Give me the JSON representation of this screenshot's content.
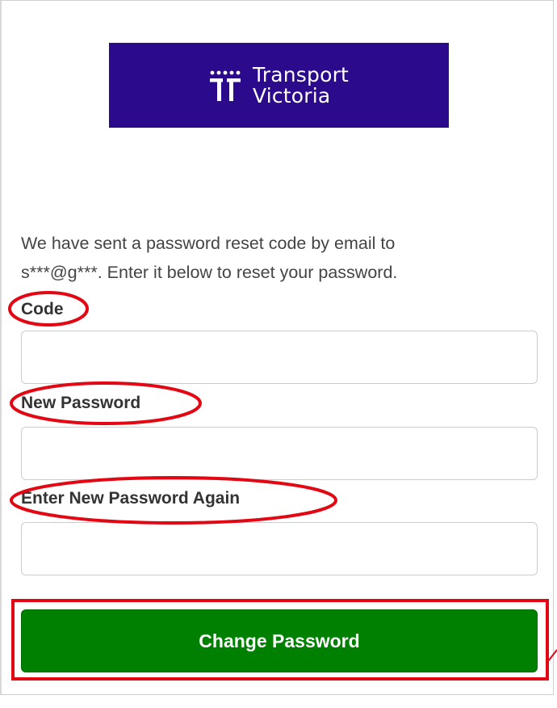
{
  "logo": {
    "line1": "Transport",
    "line2": "Victoria",
    "background": "#2b0a8c"
  },
  "intro": {
    "line1": "We have sent a password reset code by email to",
    "line2": "s***@g***. Enter it below to reset your password."
  },
  "form": {
    "code_label": "Code",
    "code_value": "",
    "new_password_label": "New Password",
    "new_password_value": "",
    "confirm_password_label": "Enter New Password Again",
    "confirm_password_value": "",
    "submit_label": "Change Password"
  },
  "colors": {
    "button": "#008000",
    "annotation": "#e30613"
  }
}
